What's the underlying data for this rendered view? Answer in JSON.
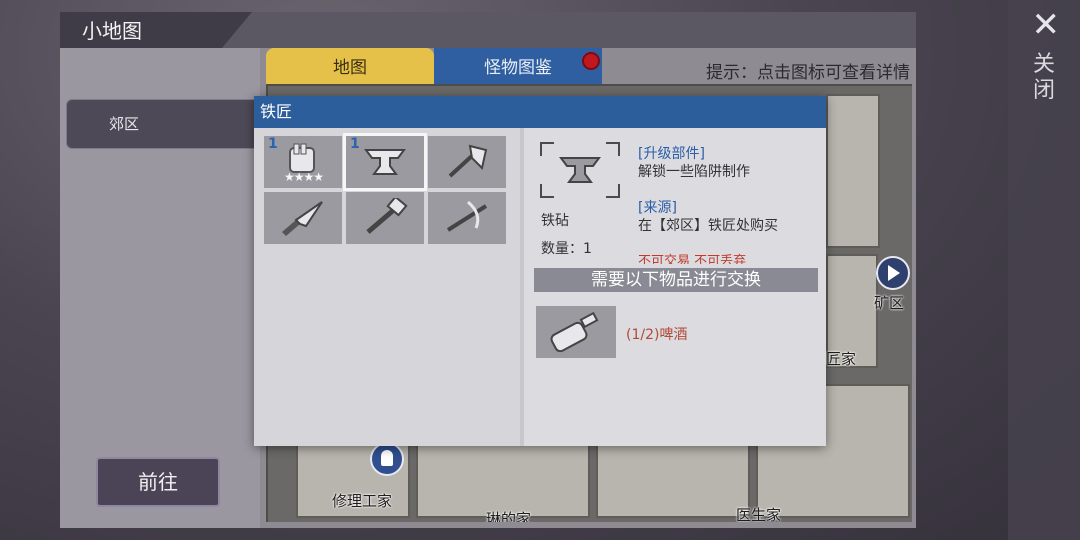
{
  "window": {
    "title": "小地图",
    "close_label": "关闭",
    "close_icon": "close-icon"
  },
  "sidebar": {
    "region": "郊区",
    "go_label": "前往"
  },
  "tabs": [
    {
      "label": "地图",
      "active": true
    },
    {
      "label": "怪物图鉴",
      "active": false,
      "badge": true
    }
  ],
  "hint": "提示：点击图标可查看详情",
  "map": {
    "labels": [
      "矿区",
      "匠家",
      "修理工家",
      "琳的家",
      "医生家"
    ],
    "icons": [
      "arrow-right-icon",
      "person-icon"
    ]
  },
  "dialog": {
    "title": "铁匠",
    "slots": [
      {
        "icon": "glove-icon",
        "count": "1",
        "stars": "★★★★"
      },
      {
        "icon": "anvil-icon",
        "count": "1",
        "selected": true
      },
      {
        "icon": "axe-icon",
        "count": ""
      },
      {
        "icon": "knife-icon",
        "count": ""
      },
      {
        "icon": "hammer-icon",
        "count": ""
      },
      {
        "icon": "crossbow-icon",
        "count": ""
      }
    ],
    "detail": {
      "name": "铁砧",
      "quantity": "数量：1",
      "section1_title": "[升级部件]",
      "section1_text": "解锁一些陷阱制作",
      "section2_title": "[来源]",
      "section2_text": "在【郊区】铁匠处购买",
      "restrictions": "不可交易  不可丢弃",
      "exchange_header": "需要以下物品进行交换",
      "requirement": {
        "icon": "beer-bottle-icon",
        "text": "(1/2)啤酒"
      }
    }
  }
}
